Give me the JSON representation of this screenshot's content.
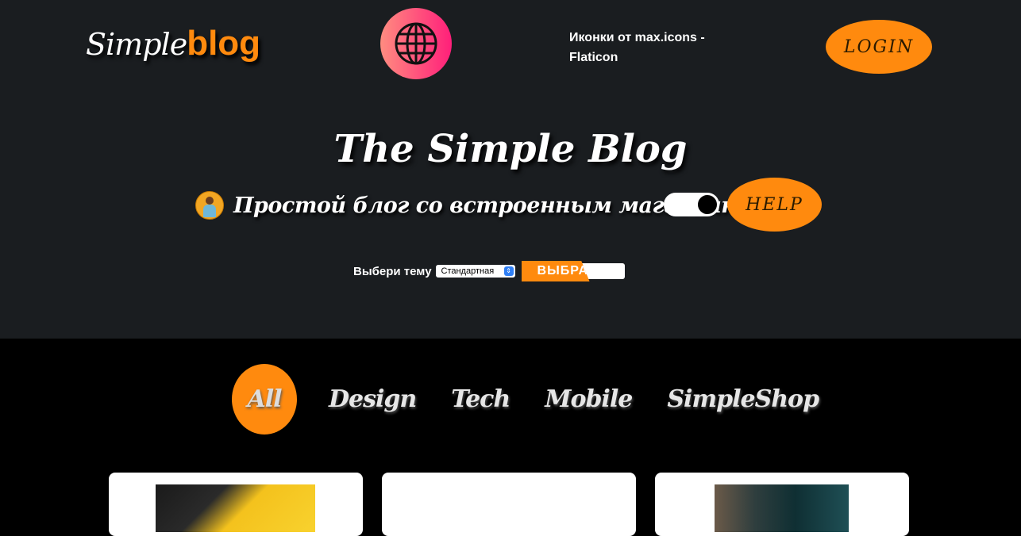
{
  "header": {
    "logo_part1": "Simple",
    "logo_part2": "blog",
    "credit": "Иконки от max.icons - Flaticon",
    "login_label": "LOGIN",
    "title": "The Simple Blog",
    "subtitle": "Простой блог со встроенным магазинном!",
    "help_label": "HELP",
    "theme_label": "Выбери тему",
    "theme_selected": "Стандартная",
    "choose_label": "ВЫБРАТЬ"
  },
  "nav": {
    "items": [
      "All",
      "Design",
      "Tech",
      "Mobile",
      "SimpleShop"
    ],
    "active": "All"
  },
  "colors": {
    "accent": "#ff8a0e",
    "header_bg": "#1a1d20",
    "body_bg": "#000000"
  },
  "icons": [
    "globe-icon",
    "avatar-icon",
    "toggle-switch",
    "select-arrow-icon"
  ]
}
